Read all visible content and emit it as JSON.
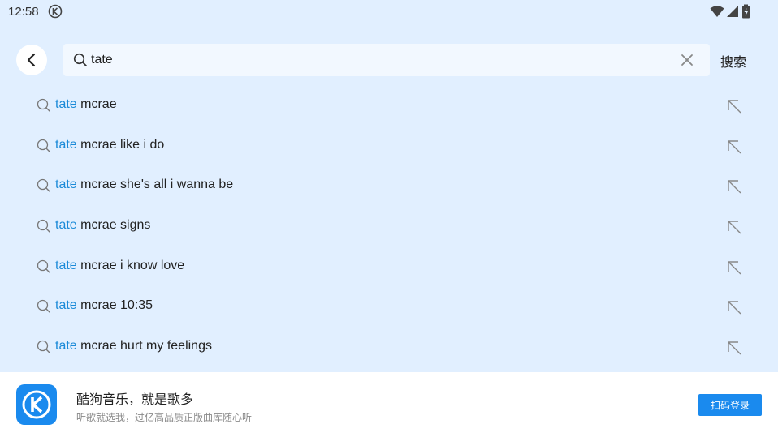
{
  "status_bar": {
    "time": "12:58",
    "app_icon": "kugou-k-icon",
    "right_icons": [
      "wifi-icon",
      "cellular-signal-icon",
      "battery-icon"
    ]
  },
  "search": {
    "back_icon": "chevron-left-icon",
    "query": "tate",
    "clear_icon": "close-icon",
    "action_label": "搜索"
  },
  "suggestions": [
    {
      "highlight": "tate",
      "rest": " mcrae"
    },
    {
      "highlight": "tate",
      "rest": " mcrae like i do"
    },
    {
      "highlight": "tate",
      "rest": " mcrae she's all i wanna be"
    },
    {
      "highlight": "tate",
      "rest": " mcrae signs"
    },
    {
      "highlight": "tate",
      "rest": " mcrae i know love"
    },
    {
      "highlight": "tate",
      "rest": " mcrae 10:35"
    },
    {
      "highlight": "tate",
      "rest": " mcrae hurt my feelings"
    }
  ],
  "banner": {
    "title": "酷狗音乐，就是歌多",
    "subtitle": "听歌就选我，过亿高品质正版曲库随心听",
    "button_label": "扫码登录"
  },
  "colors": {
    "background": "#e1efff",
    "accent": "#1a8aee",
    "highlight_text": "#1a8ad8"
  }
}
